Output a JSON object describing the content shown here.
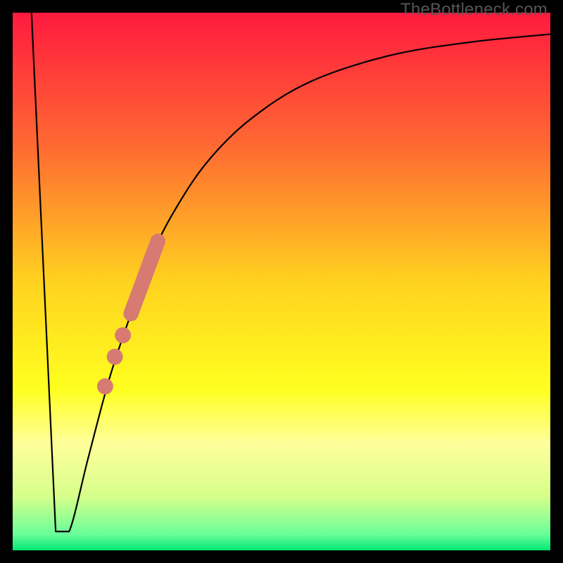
{
  "watermark": "TheBottleneck.com",
  "chart_data": {
    "type": "line",
    "title": "",
    "xlabel": "",
    "ylabel": "",
    "xlim": [
      0,
      100
    ],
    "ylim": [
      0,
      100
    ],
    "background_gradient": {
      "stops": [
        {
          "offset": 0.0,
          "color": "#ff1a3f"
        },
        {
          "offset": 0.25,
          "color": "#ff6a32"
        },
        {
          "offset": 0.5,
          "color": "#ffd21f"
        },
        {
          "offset": 0.7,
          "color": "#ffff1f"
        },
        {
          "offset": 0.8,
          "color": "#ffff9a"
        },
        {
          "offset": 0.9,
          "color": "#d6ff8a"
        },
        {
          "offset": 0.97,
          "color": "#6aff9a"
        },
        {
          "offset": 1.0,
          "color": "#00e874"
        }
      ]
    },
    "series": [
      {
        "name": "bottleneck-curve",
        "points": [
          {
            "x": 3.5,
            "y": 100
          },
          {
            "x": 8.0,
            "y": 3.5
          },
          {
            "x": 10.5,
            "y": 3.5
          },
          {
            "x": 14.0,
            "y": 17
          },
          {
            "x": 18.0,
            "y": 32
          },
          {
            "x": 22.0,
            "y": 44
          },
          {
            "x": 26.0,
            "y": 55
          },
          {
            "x": 30.0,
            "y": 63
          },
          {
            "x": 36.0,
            "y": 72
          },
          {
            "x": 44.0,
            "y": 80
          },
          {
            "x": 55.0,
            "y": 87
          },
          {
            "x": 70.0,
            "y": 92
          },
          {
            "x": 85.0,
            "y": 94.5
          },
          {
            "x": 100.0,
            "y": 96
          }
        ]
      }
    ],
    "dash_markers": {
      "name": "highlighted-segment",
      "color": "#d77a72",
      "pill": {
        "x1": 22.0,
        "y1": 44.0,
        "x2": 27.0,
        "y2": 57.5,
        "width": 2.8
      },
      "dots": [
        {
          "x": 20.5,
          "y": 40.0,
          "r": 1.5
        },
        {
          "x": 19.0,
          "y": 36.0,
          "r": 1.5
        },
        {
          "x": 17.2,
          "y": 30.5,
          "r": 1.5
        }
      ]
    }
  }
}
